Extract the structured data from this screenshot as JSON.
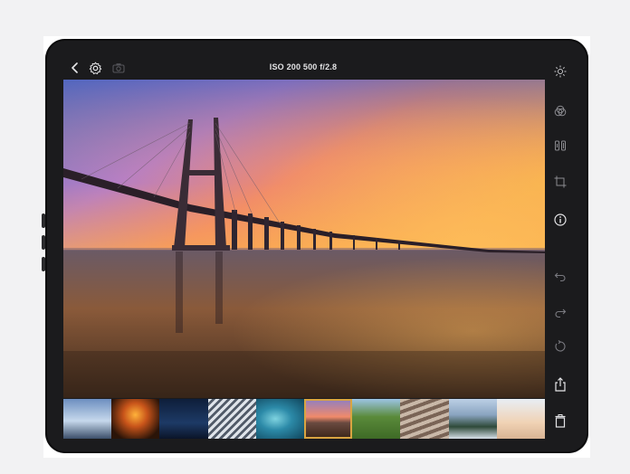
{
  "toolbar": {
    "exif": "ISO 200   500   f/2.8",
    "back_icon": "chevron-left-icon",
    "settings_icon": "gear-icon",
    "camera_icon": "camera-icon"
  },
  "sidebar": {
    "items": [
      {
        "name": "brightness-icon"
      },
      {
        "name": "color-filter-icon"
      },
      {
        "name": "adjust-icon"
      },
      {
        "name": "crop-icon"
      },
      {
        "name": "info-icon"
      },
      {
        "name": "undo-icon"
      },
      {
        "name": "redo-icon"
      },
      {
        "name": "revert-icon"
      },
      {
        "name": "share-icon"
      },
      {
        "name": "delete-icon"
      }
    ]
  },
  "filmstrip": {
    "count": 10,
    "selected_index": 5
  },
  "colors": {
    "device": "#1b1b1d",
    "icon": "#d8d8da",
    "icon_dim": "#6b6b70",
    "selection": "#d9a441"
  }
}
